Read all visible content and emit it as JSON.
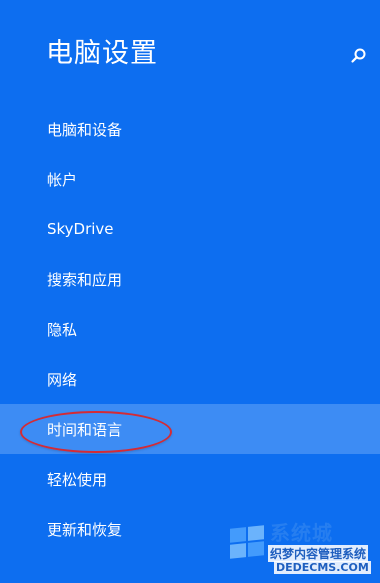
{
  "header": {
    "title": "电脑设置",
    "search_icon": "search-icon"
  },
  "nav": {
    "items": [
      {
        "label": "电脑和设备",
        "selected": false
      },
      {
        "label": "帐户",
        "selected": false
      },
      {
        "label": "SkyDrive",
        "selected": false
      },
      {
        "label": "搜索和应用",
        "selected": false
      },
      {
        "label": "隐私",
        "selected": false
      },
      {
        "label": "网络",
        "selected": false
      },
      {
        "label": "时间和语言",
        "selected": true
      },
      {
        "label": "轻松使用",
        "selected": false
      },
      {
        "label": "更新和恢复",
        "selected": false
      }
    ]
  },
  "annotation": {
    "highlight_color": "#d42b35"
  },
  "watermark": {
    "brand": "系统城",
    "cn": "织梦内容管理系统",
    "url": "DEDECMS.COM"
  },
  "colors": {
    "background": "#0d6ef0",
    "selected": "#3d8cf4",
    "text": "#ffffff"
  }
}
